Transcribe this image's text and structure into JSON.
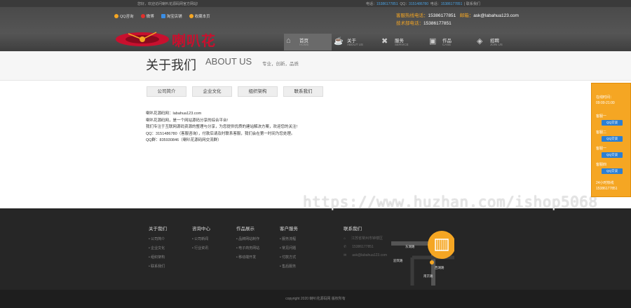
{
  "topbar": {
    "welcome": "您好，欢迎访问喇叭花源码网官方网站!",
    "phone_label": "电话：",
    "phone": "15386177851",
    "qq_label": "QQ：",
    "qq": "3151486780",
    "mobile_label": "电话：",
    "mobile": "15386177851",
    "contact_link": "联系我们"
  },
  "quick_links": [
    {
      "label": "QQ咨询",
      "icon": "star-icon",
      "color": "#f5a623"
    },
    {
      "label": "微博",
      "icon": "weibo-icon",
      "color": "#e0302c"
    },
    {
      "label": "淘宝店铺",
      "icon": "shop-icon",
      "color": "#3a8ee6"
    },
    {
      "label": "收藏本页",
      "icon": "star-icon",
      "color": "#f5a623"
    }
  ],
  "hotline": {
    "sales_label": "客服热线电话：",
    "sales_phone": "15386177851",
    "email_label": "邮箱：",
    "email": "ask@labahua123.com",
    "tech_label": "技术部电话：",
    "tech_phone": "15386177851"
  },
  "logo": {
    "text": "喇叭花"
  },
  "nav": [
    {
      "label": "首页",
      "en": "HOME",
      "icon": "home-icon",
      "glyph": "⌂",
      "active": true
    },
    {
      "label": "关于",
      "en": "ABOUT US",
      "icon": "coffee-icon",
      "glyph": "☕",
      "active": false
    },
    {
      "label": "服务",
      "en": "SERVICE",
      "icon": "tools-icon",
      "glyph": "✖",
      "active": false
    },
    {
      "label": "作品",
      "en": "CASE",
      "icon": "gallery-icon",
      "glyph": "▣",
      "active": false
    },
    {
      "label": "招聘",
      "en": "JOIN US",
      "icon": "box-icon",
      "glyph": "◈",
      "active": false
    }
  ],
  "banner": {
    "title": "关于我们",
    "en": "ABOUT US",
    "sub": "专业，创新，品质"
  },
  "tabs": [
    "公司简介",
    "企业文化",
    "组织架构",
    "联系我们"
  ],
  "content": [
    "喇叭花源码网：labahua123.com",
    "喇叭花源码网，是一个网站源码分享的综合平台!",
    "我们专注于互联网源码资源的整理与分享，为您提供优质的建站解决方案，欢迎您的关注!",
    "QQ：3151486780（客服咨询），付款后请及时联系客服，我们会在第一时间为您处理。",
    "QQ群：835930846（喇叭花源码网交流群）"
  ],
  "watermark": "https://www.huzhan.com/ishop5068",
  "footer": {
    "columns": [
      {
        "heading": "关于我们",
        "items": [
          "公司简介",
          "企业文化",
          "组织架构",
          "联系我们"
        ]
      },
      {
        "heading": "咨询中心",
        "items": [
          "公司新闻",
          "行业资讯"
        ]
      },
      {
        "heading": "作品展示",
        "items": [
          "品牌网站制作",
          "电子商务网站",
          "移动端开发"
        ]
      },
      {
        "heading": "客户服务",
        "items": [
          "服务流程",
          "常见问题",
          "付款方式",
          "售后服务"
        ]
      }
    ],
    "contact": {
      "heading": "联系我们",
      "address": "江苏省常州市钟楼区",
      "phone": "15386177851",
      "email": "ask@labahua123.com"
    },
    "map_labels": [
      "东湖路",
      "迎宾路",
      "西湖路",
      "南京路"
    ],
    "copyright": "copyright 2020 喇叭花源码网 版权所有"
  },
  "side": {
    "hours_label": "在线时间：",
    "hours": "09:00-21:00",
    "agents": [
      {
        "name": "客服一",
        "button": "QQ交谈"
      },
      {
        "name": "客服二",
        "button": "QQ交谈"
      },
      {
        "name": "客服一",
        "button": "QQ交谈"
      },
      {
        "name": "客服四",
        "button": "QQ交谈"
      }
    ],
    "tel_label": "24小时热线",
    "tel": "15386177851"
  }
}
